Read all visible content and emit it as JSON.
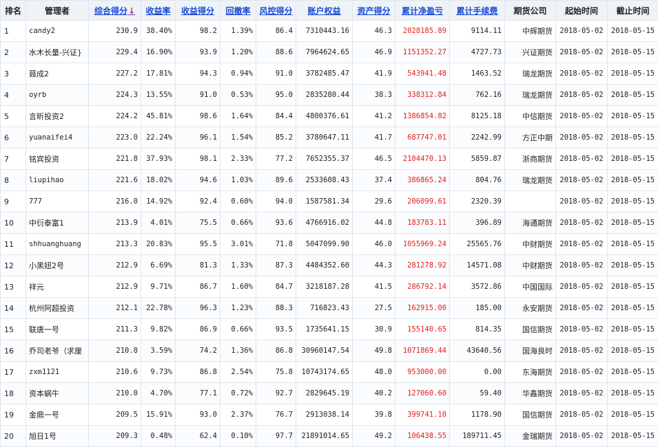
{
  "headers": [
    "排名",
    "管理者",
    "综合得分",
    "收益率",
    "收益得分",
    "回撤率",
    "风控得分",
    "账户权益",
    "资产得分",
    "累计净盈亏",
    "累计手续费",
    "期货公司",
    "起始时间",
    "截止时间"
  ],
  "sort_arrow": "↓",
  "rows": [
    {
      "rank": "1",
      "manager": "candy2",
      "score": "230.9",
      "return_rate": "38.40%",
      "return_score": "98.2",
      "drawdown": "1.39%",
      "risk_score": "86.4",
      "equity": "7310443.16",
      "asset_score": "46.3",
      "net_pnl": "2028185.89",
      "fees": "9114.11",
      "company": "中辉期货",
      "start": "2018-05-02",
      "end": "2018-05-15"
    },
    {
      "rank": "2",
      "manager": "水木长量-兴证期",
      "manager_display": "水木长量-兴证}",
      "return_rate": "16.90%",
      "score": "229.4",
      "return_score": "93.9",
      "drawdown": "1.20%",
      "risk_score": "88.6",
      "equity": "7964624.65",
      "asset_score": "46.9",
      "net_pnl": "1151352.27",
      "fees": "4727.73",
      "company": "兴证期货",
      "start": "2018-05-02",
      "end": "2018-05-15"
    },
    {
      "rank": "3",
      "manager": "聂成2",
      "score": "227.2",
      "return_rate": "17.81%",
      "return_score": "94.3",
      "drawdown": "0.94%",
      "risk_score": "91.0",
      "equity": "3782485.47",
      "asset_score": "41.9",
      "net_pnl": "543941.48",
      "fees": "1463.52",
      "company": "瑞龙期货",
      "start": "2018-05-02",
      "end": "2018-05-15"
    },
    {
      "rank": "4",
      "manager": "oyrb",
      "score": "224.3",
      "return_rate": "13.55%",
      "return_score": "91.0",
      "drawdown": "0.53%",
      "risk_score": "95.0",
      "equity": "2835280.44",
      "asset_score": "38.3",
      "net_pnl": "338312.84",
      "fees": "762.16",
      "company": "瑞龙期货",
      "start": "2018-05-02",
      "end": "2018-05-15"
    },
    {
      "rank": "5",
      "manager": "言昕投资2",
      "score": "224.2",
      "return_rate": "45.81%",
      "return_score": "98.6",
      "drawdown": "1.64%",
      "risk_score": "84.4",
      "equity": "4800376.61",
      "asset_score": "41.2",
      "net_pnl": "1386854.82",
      "fees": "8125.18",
      "company": "中信期货",
      "start": "2018-05-02",
      "end": "2018-05-15"
    },
    {
      "rank": "6",
      "manager": "yuanaifei4",
      "score": "223.0",
      "return_rate": "22.24%",
      "return_score": "96.1",
      "drawdown": "1.54%",
      "risk_score": "85.2",
      "equity": "3780647.11",
      "asset_score": "41.7",
      "net_pnl": "687747.01",
      "fees": "2242.99",
      "company": "方正中期",
      "start": "2018-05-02",
      "end": "2018-05-15"
    },
    {
      "rank": "7",
      "manager": "铭宾投资",
      "score": "221.8",
      "return_rate": "37.93%",
      "return_score": "98.1",
      "drawdown": "2.33%",
      "risk_score": "77.2",
      "equity": "7652355.37",
      "asset_score": "46.5",
      "net_pnl": "2104470.13",
      "fees": "5859.87",
      "company": "浙商期货",
      "start": "2018-05-02",
      "end": "2018-05-15"
    },
    {
      "rank": "8",
      "manager": "liupihao",
      "score": "221.6",
      "return_rate": "18.02%",
      "return_score": "94.6",
      "drawdown": "1.03%",
      "risk_score": "89.6",
      "equity": "2533608.43",
      "asset_score": "37.4",
      "net_pnl": "386865.24",
      "fees": "804.76",
      "company": "瑞龙期货",
      "start": "2018-05-02",
      "end": "2018-05-15"
    },
    {
      "rank": "9",
      "manager": "777",
      "score": "216.0",
      "return_rate": "14.92%",
      "return_score": "92.4",
      "drawdown": "0.60%",
      "risk_score": "94.0",
      "equity": "1587581.34",
      "asset_score": "29.6",
      "net_pnl": "206099.61",
      "fees": "2320.39",
      "company": "",
      "start": "2018-05-02",
      "end": "2018-05-15"
    },
    {
      "rank": "10",
      "manager": "中衍泰富1",
      "score": "213.9",
      "return_rate": "4.01%",
      "return_score": "75.5",
      "drawdown": "0.66%",
      "risk_score": "93.6",
      "equity": "4766916.02",
      "asset_score": "44.8",
      "net_pnl": "183783.11",
      "fees": "396.89",
      "company": "海通期货",
      "start": "2018-05-02",
      "end": "2018-05-15"
    },
    {
      "rank": "11",
      "manager": "shhuanghuang",
      "score": "213.3",
      "return_rate": "20.83%",
      "return_score": "95.5",
      "drawdown": "3.01%",
      "risk_score": "71.8",
      "equity": "5047099.90",
      "asset_score": "46.0",
      "net_pnl": "1055969.24",
      "fees": "25565.76",
      "company": "中财期货",
      "start": "2018-05-02",
      "end": "2018-05-15"
    },
    {
      "rank": "12",
      "manager": "小黑妞2号",
      "score": "212.9",
      "return_rate": "6.69%",
      "return_score": "81.3",
      "drawdown": "1.33%",
      "risk_score": "87.3",
      "equity": "4484352.60",
      "asset_score": "44.3",
      "net_pnl": "281278.92",
      "fees": "14571.08",
      "company": "中财期货",
      "start": "2018-05-02",
      "end": "2018-05-15"
    },
    {
      "rank": "13",
      "manager": "祥元",
      "score": "212.9",
      "return_rate": "9.71%",
      "return_score": "86.7",
      "drawdown": "1.60%",
      "risk_score": "84.7",
      "equity": "3218187.28",
      "asset_score": "41.5",
      "net_pnl": "286792.14",
      "fees": "3572.86",
      "company": "中国国际",
      "start": "2018-05-02",
      "end": "2018-05-15"
    },
    {
      "rank": "14",
      "manager": "杭州阿超投资",
      "score": "212.1",
      "return_rate": "22.78%",
      "return_score": "96.3",
      "drawdown": "1.23%",
      "risk_score": "88.3",
      "equity": "716823.43",
      "asset_score": "27.5",
      "net_pnl": "162915.00",
      "fees": "185.00",
      "company": "永安期货",
      "start": "2018-05-02",
      "end": "2018-05-15"
    },
    {
      "rank": "15",
      "manager": "联唐一号",
      "score": "211.3",
      "return_rate": "9.82%",
      "return_score": "86.9",
      "drawdown": "0.66%",
      "risk_score": "93.5",
      "equity": "1735641.15",
      "asset_score": "30.9",
      "net_pnl": "155140.65",
      "fees": "814.35",
      "company": "国信期货",
      "start": "2018-05-02",
      "end": "2018-05-15"
    },
    {
      "rank": "16",
      "manager": "乔司老爷（求厘",
      "manager_display": "乔司老爷（求厘",
      "score": "210.8",
      "return_rate": "3.59%",
      "return_score": "74.2",
      "drawdown": "1.36%",
      "risk_score": "86.8",
      "equity": "30960147.54",
      "asset_score": "49.8",
      "net_pnl": "1071869.44",
      "fees": "43640.56",
      "company": "国海良时",
      "start": "2018-05-02",
      "end": "2018-05-15"
    },
    {
      "rank": "17",
      "manager": "zxm1121",
      "score": "210.6",
      "return_rate": "9.73%",
      "return_score": "86.8",
      "drawdown": "2.54%",
      "risk_score": "75.8",
      "equity": "10743174.65",
      "asset_score": "48.0",
      "net_pnl": "953000.00",
      "fees": "0.00",
      "company": "东海期货",
      "start": "2018-05-02",
      "end": "2018-05-15"
    },
    {
      "rank": "18",
      "manager": "资本蜗牛",
      "score": "210.0",
      "return_rate": "4.70%",
      "return_score": "77.1",
      "drawdown": "0.72%",
      "risk_score": "92.7",
      "equity": "2829645.19",
      "asset_score": "40.2",
      "net_pnl": "127060.60",
      "fees": "59.40",
      "company": "华鑫期货",
      "start": "2018-05-02",
      "end": "2018-05-15"
    },
    {
      "rank": "19",
      "manager": "金鼎一号",
      "score": "209.5",
      "return_rate": "15.91%",
      "return_score": "93.0",
      "drawdown": "2.37%",
      "risk_score": "76.7",
      "equity": "2913038.14",
      "asset_score": "39.8",
      "net_pnl": "399741.10",
      "fees": "1178.90",
      "company": "国信期货",
      "start": "2018-05-02",
      "end": "2018-05-15"
    },
    {
      "rank": "20",
      "manager": "旭日1号",
      "score": "209.3",
      "return_rate": "0.48%",
      "return_score": "62.4",
      "drawdown": "0.10%",
      "risk_score": "97.7",
      "equity": "21891014.65",
      "asset_score": "49.2",
      "net_pnl": "106438.55",
      "fees": "189711.45",
      "company": "金瑞期货",
      "start": "2018-05-02",
      "end": "2018-05-15"
    }
  ],
  "colors": {
    "header_bg": "#eef3f8",
    "link": "#1a4bd6",
    "profit": "#e02020",
    "grid": "#dfe6ee"
  }
}
